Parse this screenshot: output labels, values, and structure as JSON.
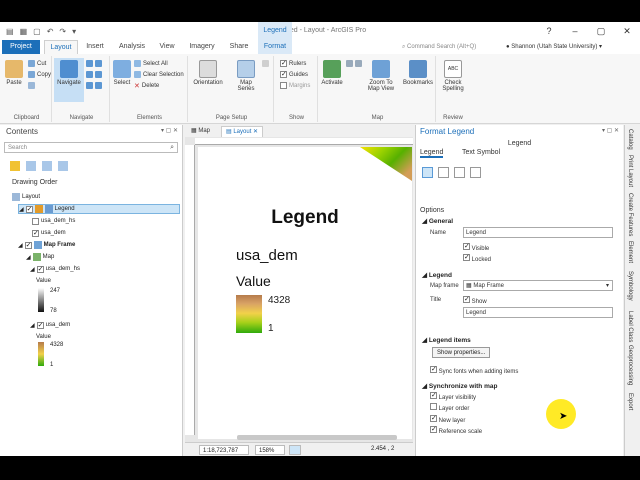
{
  "window": {
    "title": "Untitled - Layout - ArcGIS Pro",
    "context_header": "Legend"
  },
  "tabs": [
    "Project",
    "Layout",
    "Insert",
    "Analysis",
    "View",
    "Imagery",
    "Share",
    "Format"
  ],
  "active_tab": "Layout",
  "command_search_placeholder": "Command Search (Alt+Q)",
  "user": "Shannon (Utah State University)",
  "ribbon": {
    "clipboard": {
      "paste": "Paste",
      "cut": "Cut",
      "copy": "Copy",
      "label": "Clipboard"
    },
    "navigate": {
      "navigate": "Navigate",
      "label": "Navigate"
    },
    "elements": {
      "select": "Select",
      "select_all": "Select All",
      "clear_selection": "Clear Selection",
      "delete": "Delete",
      "label": "Elements"
    },
    "page_setup": {
      "orientation": "Orientation",
      "map_series": "Map Series",
      "label": "Page Setup"
    },
    "show": {
      "rulers": "Rulers",
      "guides": "Guides",
      "margins": "Margins",
      "label": "Show"
    },
    "map": {
      "activate": "Activate",
      "zoom_to_map_view": "Zoom To Map View",
      "bookmarks": "Bookmarks",
      "label": "Map"
    },
    "review": {
      "check_spelling": "Check Spelling",
      "label": "Review"
    }
  },
  "contents": {
    "title": "Contents",
    "search_placeholder": "Search",
    "drawing_order": "Drawing Order",
    "tree": {
      "layout": "Layout",
      "legend": "Legend",
      "usa_dem_hs": "usa_dem_hs",
      "usa_dem": "usa_dem",
      "map_frame": "Map Frame",
      "map": "Map",
      "usa_dem_hs2": "usa_dem_hs",
      "value_label": "Value",
      "hs_high": "247",
      "hs_low": "78",
      "usa_dem2": "usa_dem",
      "value_label2": "Value",
      "dem_high": "4328",
      "dem_low": "1"
    }
  },
  "view_tabs": [
    "Map",
    "Layout"
  ],
  "layout_legend": {
    "title": "Legend",
    "layer": "usa_dem",
    "field": "Value",
    "high": "4328",
    "low": "1"
  },
  "status": {
    "scale": "1:18,723,787",
    "zoom": "158%",
    "coords": "2.454 , 2"
  },
  "format_pane": {
    "title": "Format Legend",
    "subtitle": "Legend",
    "tab_legend": "Legend",
    "tab_text_symbol": "Text Symbol",
    "options": "Options",
    "general": "General",
    "name_label": "Name",
    "name_value": "Legend",
    "visible": "Visible",
    "locked": "Locked",
    "legend_section": "Legend",
    "map_frame_label": "Map frame",
    "map_frame_value": "Map Frame",
    "title_label": "Title",
    "show": "Show",
    "title_value": "Legend",
    "legend_items": "Legend items",
    "show_properties": "Show properties...",
    "sync_fonts": "Sync fonts when adding items",
    "sync_map": "Synchronize with map",
    "layer_visibility": "Layer visibility",
    "layer_order": "Layer order",
    "new_layer": "New layer",
    "reference_scale": "Reference scale"
  },
  "right_tabs": [
    "Catalog",
    "Print Layout",
    "Create Features",
    "Element",
    "Symbology",
    "Label Class",
    "Geoprocessing",
    "Export"
  ]
}
